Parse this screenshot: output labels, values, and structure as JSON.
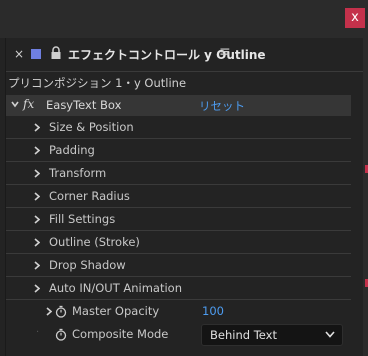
{
  "window": {
    "close_label": "x"
  },
  "tab": {
    "close_label": "×",
    "title": "エフェクトコントロール y Outline",
    "menu_label": "≡",
    "label_color": "#6f7fe0"
  },
  "breadcrumb": "プリコンポジション 1・y Outline",
  "effect": {
    "fx_label": "fx",
    "name": "EasyText Box",
    "reset_label": "リセット"
  },
  "groups": [
    {
      "label": "Size & Position"
    },
    {
      "label": "Padding"
    },
    {
      "label": "Transform"
    },
    {
      "label": "Corner Radius"
    },
    {
      "label": "Fill Settings"
    },
    {
      "label": "Outline (Stroke)"
    },
    {
      "label": "Drop Shadow"
    },
    {
      "label": "Auto IN/OUT Animation"
    }
  ],
  "properties": {
    "master_opacity": {
      "label": "Master Opacity",
      "value": "100"
    },
    "composite_mode": {
      "label": "Composite Mode",
      "selected": "Behind Text"
    }
  },
  "colors": {
    "accent_blue": "#4d9cf0",
    "close_red": "#c4314b"
  }
}
